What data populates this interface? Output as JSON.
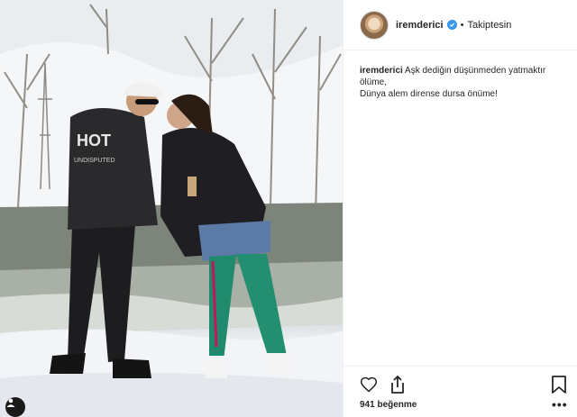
{
  "header": {
    "username": "iremderici",
    "verified_icon": "verified-badge-icon",
    "separator": "•",
    "follow_status": "Takiptesin"
  },
  "caption": {
    "username": "iremderici",
    "line1": "Aşk dediğin düşünmeden yatmaktır ölüme,",
    "line2": "Dünya alem dirense dursa önüme!"
  },
  "post_image": {
    "jacket_text_line1": "HOT",
    "jacket_text_line2": "UNDISPUTED",
    "tagged_icon": "user-tag-icon"
  },
  "actions": {
    "like_icon": "heart-icon",
    "share_icon": "share-icon",
    "save_icon": "bookmark-icon",
    "more_icon": "more-options-icon",
    "more_label": "•••"
  },
  "likes": {
    "text": "941 beğenme"
  },
  "colors": {
    "verified": "#3897f0",
    "text": "#262626",
    "border": "#efefef"
  }
}
